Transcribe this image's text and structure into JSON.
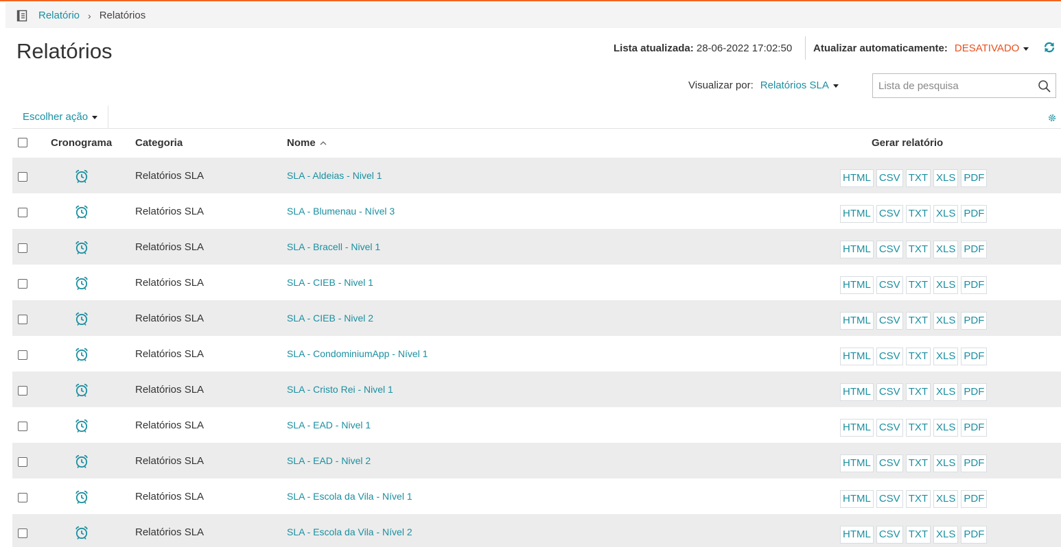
{
  "breadcrumb": {
    "parent": "Relatório",
    "separator": "›",
    "current": "Relatórios"
  },
  "page": {
    "title": "Relatórios"
  },
  "status": {
    "updated_label": "Lista atualizada:",
    "updated_value": "28-06-2022 17:02:50",
    "auto_label": "Atualizar automaticamente:",
    "auto_value": "DESATIVADO"
  },
  "view": {
    "label": "Visualizar por:",
    "selected": "Relatórios SLA"
  },
  "search": {
    "placeholder": "Lista de pesquisa",
    "value": ""
  },
  "actions": {
    "choose_label": "Escolher ação"
  },
  "table": {
    "headers": {
      "schedule": "Cronograma",
      "category": "Categoria",
      "name": "Nome",
      "generate": "Gerar relatório"
    },
    "formats": [
      "HTML",
      "CSV",
      "TXT",
      "XLS",
      "PDF"
    ],
    "rows": [
      {
        "category": "Relatórios SLA",
        "name": "SLA - Aldeias - Nivel 1"
      },
      {
        "category": "Relatórios SLA",
        "name": "SLA - Blumenau - Nível 3"
      },
      {
        "category": "Relatórios SLA",
        "name": "SLA - Bracell - Nivel 1"
      },
      {
        "category": "Relatórios SLA",
        "name": "SLA - CIEB - Nivel 1"
      },
      {
        "category": "Relatórios SLA",
        "name": "SLA - CIEB - Nivel 2"
      },
      {
        "category": "Relatórios SLA",
        "name": "SLA - CondominiumApp - Nível 1"
      },
      {
        "category": "Relatórios SLA",
        "name": "SLA - Cristo Rei - Nivel 1"
      },
      {
        "category": "Relatórios SLA",
        "name": "SLA - EAD - Nivel 1"
      },
      {
        "category": "Relatórios SLA",
        "name": "SLA - EAD - Nivel 2"
      },
      {
        "category": "Relatórios SLA",
        "name": "SLA - Escola da Vila - Nível 1"
      },
      {
        "category": "Relatórios SLA",
        "name": "SLA - Escola da Vila - Nível 2"
      }
    ]
  },
  "colors": {
    "accent": "#1a8fa0",
    "warning": "#e8501e",
    "brand": "#f26522",
    "row_alt": "#ececec"
  },
  "icons": [
    "report-icon",
    "refresh-icon",
    "search-icon",
    "gear-icon",
    "alarm-clock-icon",
    "sort-ascending-icon",
    "caret-down-icon"
  ]
}
